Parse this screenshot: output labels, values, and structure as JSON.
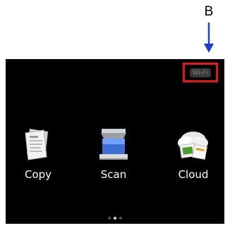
{
  "callout": {
    "label": "B",
    "color": "#1a3fd6"
  },
  "status": {
    "wifi_label": "Wi-Fi",
    "highlight_color": "#e8141b"
  },
  "apps": [
    {
      "label": "Copy",
      "icon": "copy-icon"
    },
    {
      "label": "Scan",
      "icon": "scan-icon"
    },
    {
      "label": "Cloud",
      "icon": "cloud-icon"
    }
  ],
  "pager": {
    "pages": 3,
    "current": 2
  }
}
